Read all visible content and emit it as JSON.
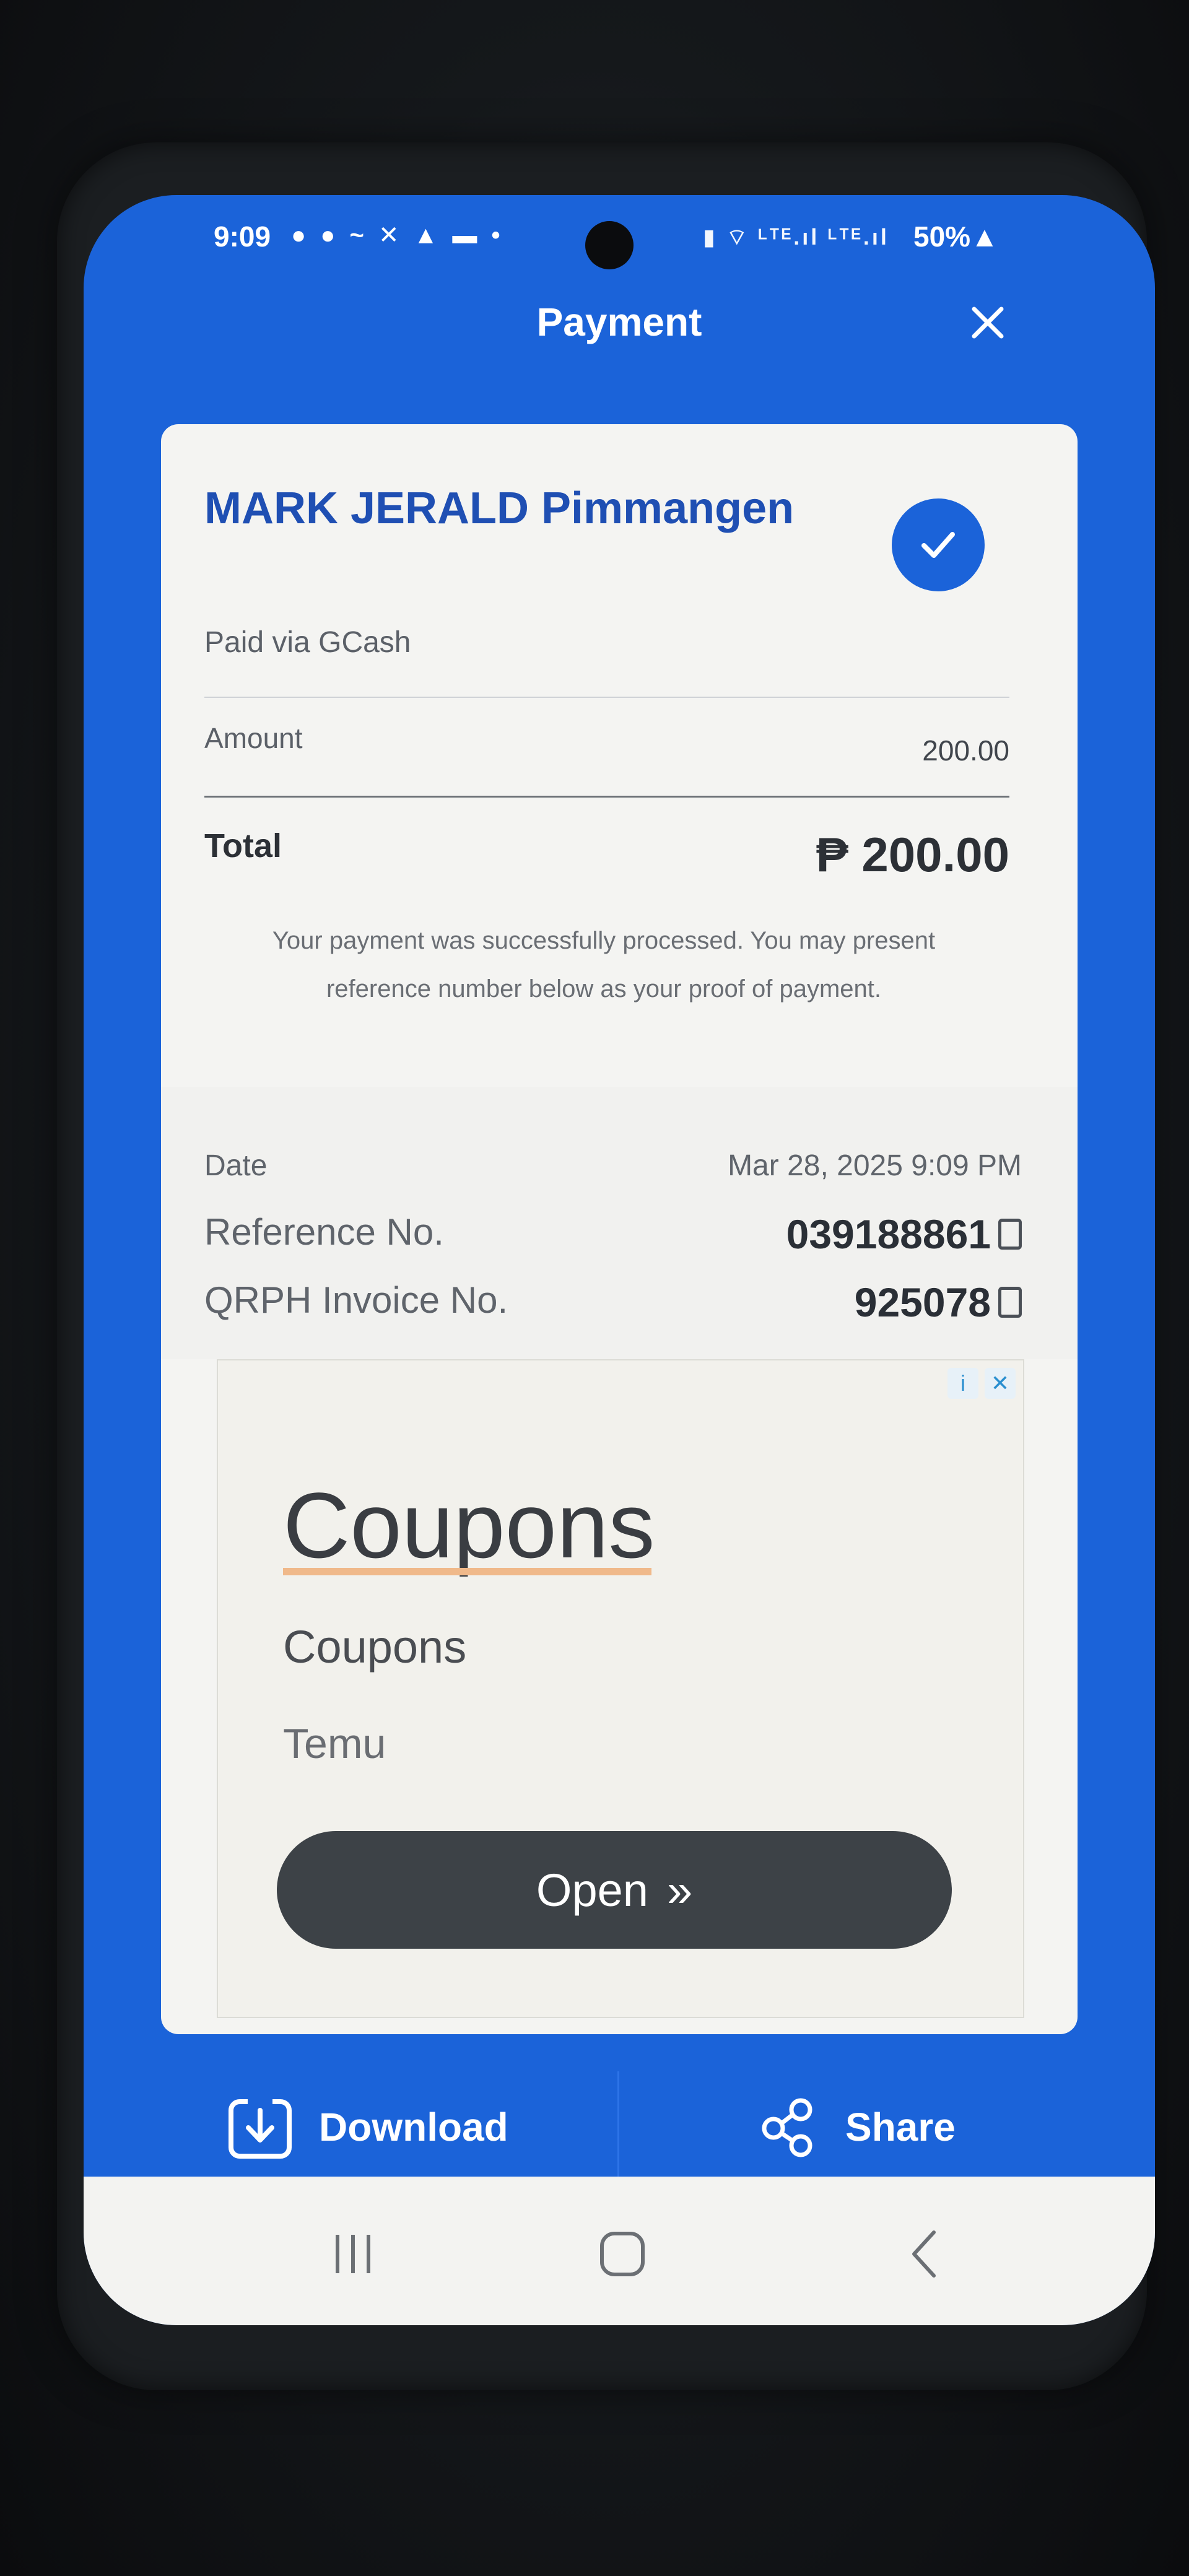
{
  "status_bar": {
    "time": "9:09",
    "left_icons": "● ● ~ ✕ ▲ ▬ •",
    "right_icons": "▮ ⌔ ᴸᵀᴱ.ıl ᴸᵀᴱ.ıl",
    "battery": "50%▲"
  },
  "header": {
    "title": "Payment"
  },
  "receipt": {
    "payee_name": "MARK JERALD Pimmangen",
    "paid_via": "Paid via GCash",
    "amount_label": "Amount",
    "amount_value": "200.00",
    "total_label": "Total",
    "total_value": "₱ 200.00",
    "message": "Your payment was successfully processed. You may present reference number below as your proof of payment.",
    "date_label": "Date",
    "date_value": "Mar 28, 2025 9:09 PM",
    "reference_label": "Reference No.",
    "reference_value": "039188861",
    "invoice_label": "QRPH Invoice No.",
    "invoice_value": "925078"
  },
  "ad": {
    "info_glyph": "i",
    "close_glyph": "✕",
    "headline": "Coupons",
    "body": "Coupons",
    "advertiser": "Temu",
    "cta_label": "Open",
    "cta_glyph": "»"
  },
  "actions": {
    "download_label": "Download",
    "share_label": "Share"
  },
  "colors": {
    "primary": "#1b63d9",
    "card": "#f4f4f2",
    "ad_button": "#3d4247"
  },
  "icons": {
    "close": "close-icon",
    "check": "check-icon",
    "copy": "copy-icon",
    "download": "download-icon",
    "share": "share-icon",
    "recent": "recent-apps-icon",
    "home": "home-icon",
    "back": "back-icon"
  }
}
